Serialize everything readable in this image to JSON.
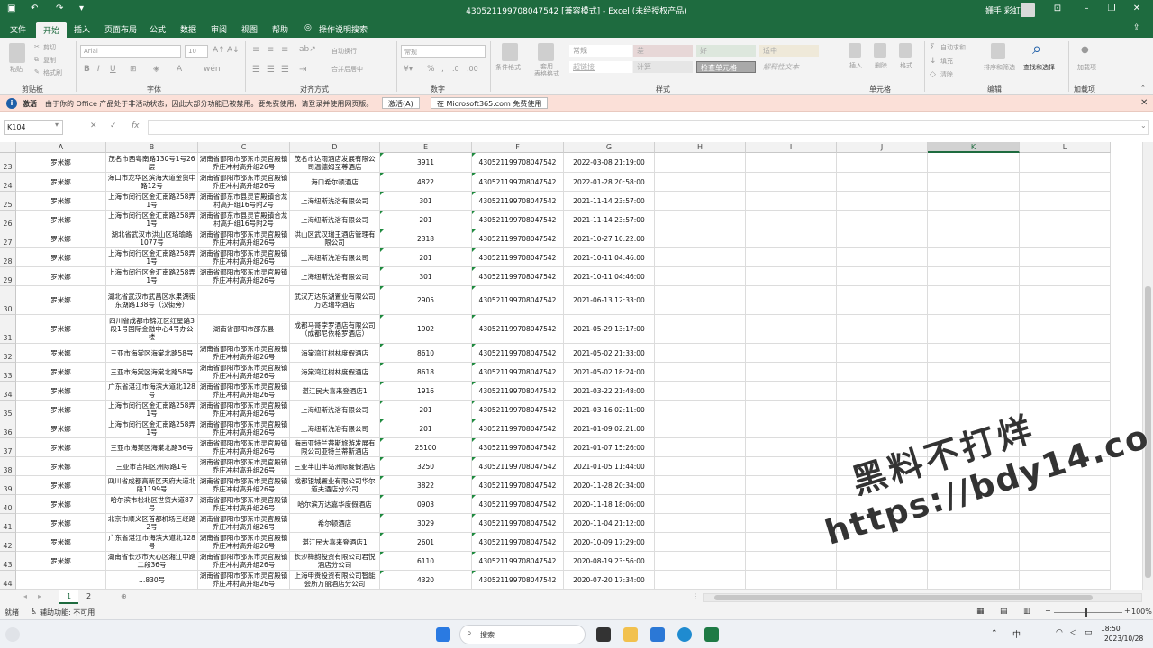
{
  "titlebar": {
    "title": "430521199708047542  [兼容模式]  -  Excel (未经授权产品)",
    "user": "姗手 彩虹",
    "undo_icon": "undo-icon",
    "redo_icon": "redo-icon"
  },
  "menu": [
    "文件",
    "开始",
    "插入",
    "页面布局",
    "公式",
    "数据",
    "审阅",
    "视图",
    "帮助",
    "操作说明搜索"
  ],
  "ribbon": {
    "clipboard": {
      "paste": "粘贴",
      "cut": "剪切",
      "copy": "复制",
      "format_painter": "格式刷",
      "label": "剪贴板"
    },
    "font": {
      "name": "Arial",
      "size": "10",
      "label": "字体"
    },
    "alignment": {
      "wrap": "自动换行",
      "merge": "合并后居中",
      "label": "对齐方式"
    },
    "number": {
      "format": "常规",
      "label": "数字"
    },
    "styles": {
      "conditional": "条件格式",
      "table": "套用\n表格格式",
      "cells": [
        "常规",
        "差",
        "好",
        "适中",
        "超链接",
        "计算",
        "检查单元格",
        "解释性文本"
      ],
      "label": "样式"
    },
    "cells": {
      "insert": "插入",
      "delete": "删除",
      "format": "格式",
      "label": "单元格"
    },
    "editing": {
      "autosum": "自动求和",
      "fill": "填充",
      "clear": "清除",
      "sort": "排序和筛选",
      "find": "查找和选择",
      "label": "编辑"
    },
    "addins": {
      "addin": "加载项",
      "label": "加载项"
    }
  },
  "notice": {
    "label": "激活",
    "text": "由于你的 Office 产品处于非活动状态，因此大部分功能已被禁用。要免费使用，请登录并使用网页版。",
    "activate": "激活(A)",
    "free": "在 Microsoft365.com 免费使用"
  },
  "namebox": "K104",
  "columns": [
    "A",
    "B",
    "C",
    "D",
    "E",
    "F",
    "G",
    "H",
    "I",
    "J",
    "K",
    "L"
  ],
  "selected_column": "K",
  "rows": [
    {
      "n": "23",
      "a": "罗米娜",
      "b": "茂名市西粤南路130号1号26层",
      "c": "湖南省邵阳市邵东市灵官殿镇乔庄冲村高升组26号",
      "d": "茂名市达雨酒店发展有限公司温德姆至尊酒店",
      "e": "3911",
      "f": "430521199708047542",
      "g": "2022-03-08  21:19:00"
    },
    {
      "n": "24",
      "a": "罗米娜",
      "b": "海口市龙华区滨海大道金贸中路12号",
      "c": "湖南省邵阳市邵东市灵官殿镇乔庄冲村高升组26号",
      "d": "海口希尔顿酒店",
      "e": "4822",
      "f": "430521199708047542",
      "g": "2022-01-28  20:58:00"
    },
    {
      "n": "25",
      "a": "罗米娜",
      "b": "上海市闵行区金汇南路258弄1号",
      "c": "湖南省邵东市县灵官殿镇合龙村高升组16号附2号",
      "d": "上海纽斯洗浴有限公司",
      "e": "301",
      "f": "430521199708047542",
      "g": "2021-11-14  23:57:00"
    },
    {
      "n": "26",
      "a": "罗米娜",
      "b": "上海市闵行区金汇南路258弄1号",
      "c": "湖南省邵东市县灵官殿镇合龙村高升组16号附2号",
      "d": "上海纽斯洗浴有限公司",
      "e": "201",
      "f": "430521199708047542",
      "g": "2021-11-14  23:57:00"
    },
    {
      "n": "27",
      "a": "罗米娜",
      "b": "湖北省武汉市洪山区珞瑜路1077号",
      "c": "湖南省邵阳市邵东市灵官殿镇乔庄冲村高升组26号",
      "d": "洪山区武汉瑞王酒店管理有限公司",
      "e": "2318",
      "f": "430521199708047542",
      "g": "2021-10-27  10:22:00"
    },
    {
      "n": "28",
      "a": "罗米娜",
      "b": "上海市闵行区金汇南路258弄1号",
      "c": "湖南省邵阳市邵东市灵官殿镇乔庄冲村高升组26号",
      "d": "上海纽斯洗浴有限公司",
      "e": "201",
      "f": "430521199708047542",
      "g": "2021-10-11  04:46:00"
    },
    {
      "n": "29",
      "a": "罗米娜",
      "b": "上海市闵行区金汇南路258弄1号",
      "c": "湖南省邵阳市邵东市灵官殿镇乔庄冲村高升组26号",
      "d": "上海纽斯洗浴有限公司",
      "e": "301",
      "f": "430521199708047542",
      "g": "2021-10-11  04:46:00"
    },
    {
      "n": "30",
      "a": "罗米娜",
      "b": "湖北省武汉市武昌区水果湖街东湖路138号（汉街旁）",
      "c": "……",
      "d": "武汉万达东湖置业有限公司万达瑞华酒店",
      "e": "2905",
      "f": "430521199708047542",
      "g": "2021-06-13  12:33:00"
    },
    {
      "n": "31",
      "a": "罗米娜",
      "b": "四川省成都市锦江区红星路3段1号国际金融中心4号办公楼",
      "c": "湖南省邵阳市邵东县",
      "d": "成都马哥孛罗酒店有限公司（成都尼依格罗酒店）",
      "e": "1902",
      "f": "430521199708047542",
      "g": "2021-05-29  13:17:00"
    },
    {
      "n": "32",
      "a": "罗米娜",
      "b": "三亚市海棠区海棠北路58号",
      "c": "湖南省邵阳市邵东市灵官殿镇乔庄冲村高升组26号",
      "d": "海棠湾红树林度假酒店",
      "e": "8610",
      "f": "430521199708047542",
      "g": "2021-05-02  21:33:00"
    },
    {
      "n": "33",
      "a": "罗米娜",
      "b": "三亚市海棠区海棠北路58号",
      "c": "湖南省邵阳市邵东市灵官殿镇乔庄冲村高升组26号",
      "d": "海棠湾红树林度假酒店",
      "e": "8618",
      "f": "430521199708047542",
      "g": "2021-05-02  18:24:00"
    },
    {
      "n": "34",
      "a": "罗米娜",
      "b": "广东省湛江市海滨大道北128号",
      "c": "湖南省邵阳市邵东市灵官殿镇乔庄冲村高升组26号",
      "d": "湛江民大喜来登酒店1",
      "e": "1916",
      "f": "430521199708047542",
      "g": "2021-03-22  21:48:00"
    },
    {
      "n": "35",
      "a": "罗米娜",
      "b": "上海市闵行区金汇南路258弄1号",
      "c": "湖南省邵阳市邵东市灵官殿镇乔庄冲村高升组26号",
      "d": "上海纽斯洗浴有限公司",
      "e": "201",
      "f": "430521199708047542",
      "g": "2021-03-16  02:11:00"
    },
    {
      "n": "36",
      "a": "罗米娜",
      "b": "上海市闵行区金汇南路258弄1号",
      "c": "湖南省邵阳市邵东市灵官殿镇乔庄冲村高升组26号",
      "d": "上海纽斯洗浴有限公司",
      "e": "201",
      "f": "430521199708047542",
      "g": "2021-01-09  02:21:00"
    },
    {
      "n": "37",
      "a": "罗米娜",
      "b": "三亚市海棠区海棠北路36号",
      "c": "湖南省邵阳市邵东市灵官殿镇乔庄冲村高升组26号",
      "d": "海南亚特兰蒂斯旅游发展有限公司亚特兰蒂斯酒店",
      "e": "25100",
      "f": "430521199708047542",
      "g": "2021-01-07  15:26:00"
    },
    {
      "n": "38",
      "a": "罗米娜",
      "b": "三亚市吉阳区洲际路1号",
      "c": "湖南省邵阳市邵东市灵官殿镇乔庄冲村高升组26号",
      "d": "三亚半山半岛洲际度假酒店",
      "e": "3250",
      "f": "430521199708047542",
      "g": "2021-01-05  11:44:00"
    },
    {
      "n": "39",
      "a": "罗米娜",
      "b": "四川省成都高新区天府大道北段1199号",
      "c": "湖南省邵阳市邵东市灵官殿镇乔庄冲村高升组26号",
      "d": "成都银城置业有限公司华尔道夫酒店分公司",
      "e": "3822",
      "f": "430521199708047542",
      "g": "2020-11-28  20:34:00"
    },
    {
      "n": "40",
      "a": "罗米娜",
      "b": "哈尔滨市松北区世贸大道87号",
      "c": "湖南省邵阳市邵东市灵官殿镇乔庄冲村高升组26号",
      "d": "哈尔滨万达嘉华度假酒店",
      "e": "0903",
      "f": "430521199708047542",
      "g": "2020-11-18  18:06:00"
    },
    {
      "n": "41",
      "a": "罗米娜",
      "b": "北京市顺义区首都机场三经路2号",
      "c": "湖南省邵阳市邵东市灵官殿镇乔庄冲村高升组26号",
      "d": "希尔顿酒店",
      "e": "3029",
      "f": "430521199708047542",
      "g": "2020-11-04  21:12:00"
    },
    {
      "n": "42",
      "a": "罗米娜",
      "b": "广东省湛江市海滨大道北128号",
      "c": "湖南省邵阳市邵东市灵官殿镇乔庄冲村高升组26号",
      "d": "湛江民大喜来登酒店1",
      "e": "2601",
      "f": "430521199708047542",
      "g": "2020-10-09  17:29:00"
    },
    {
      "n": "43",
      "a": "罗米娜",
      "b": "湖南省长沙市天心区湘江中路二段36号",
      "c": "湖南省邵阳市邵东市灵官殿镇乔庄冲村高升组26号",
      "d": "长沙梅韵投资有限公司君悦酒店分公司",
      "e": "6110",
      "f": "430521199708047542",
      "g": "2020-08-19  23:56:00"
    },
    {
      "n": "44",
      "a": "",
      "b": "…830号",
      "c": "湖南省邵阳市邵东市灵官殿镇乔庄冲村高升组26号",
      "d": "上海申贵投资有限公司智能会所万丽酒店分公司",
      "e": "4320",
      "f": "430521199708047542",
      "g": "2020-07-20  17:34:00"
    }
  ],
  "sheets": [
    "1",
    "2"
  ],
  "active_sheet": "1",
  "status": {
    "ready": "就绪",
    "accessibility": "辅助功能: 不可用",
    "zoom": "100%"
  },
  "taskbar": {
    "search": "搜索",
    "time": "18:50",
    "date": "2023/10/28"
  },
  "watermark": {
    "line1": "黑料不打烊",
    "line2": "https://bdy14.co"
  },
  "colors": {
    "accent": "#1e6b3f",
    "notice_bg": "#fbe0d8"
  }
}
